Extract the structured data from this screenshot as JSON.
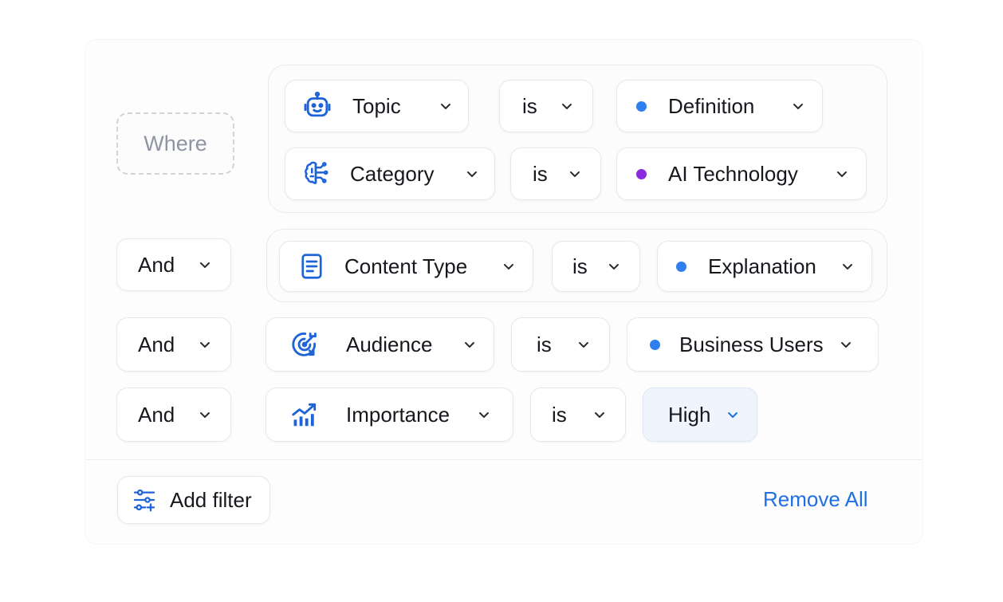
{
  "colors": {
    "accent": "#1f6fe5",
    "icon_blue": "#1f63d9",
    "dot_blue": "#2f7ff0",
    "dot_purple": "#8a2be2"
  },
  "where_label": "Where",
  "rows": {
    "r1": {
      "field": "Topic",
      "field_icon": "robot-icon",
      "operator": "is",
      "value": "Definition",
      "value_dot": "blue"
    },
    "r2": {
      "field": "Category",
      "field_icon": "brain-circuit-icon",
      "operator": "is",
      "value": "AI Technology",
      "value_dot": "purple"
    },
    "r3": {
      "conjunction": "And",
      "field": "Content Type",
      "field_icon": "document-icon",
      "operator": "is",
      "value": "Explanation",
      "value_dot": "blue"
    },
    "r4": {
      "conjunction": "And",
      "field": "Audience",
      "field_icon": "target-icon",
      "operator": "is",
      "value": "Business Users",
      "value_dot": "blue"
    },
    "r5": {
      "conjunction": "And",
      "field": "Importance",
      "field_icon": "chart-up-icon",
      "operator": "is",
      "value": "High"
    }
  },
  "footer": {
    "add_filter_label": "Add filter",
    "add_filter_icon": "sliders-plus-icon",
    "remove_all_label": "Remove All"
  }
}
